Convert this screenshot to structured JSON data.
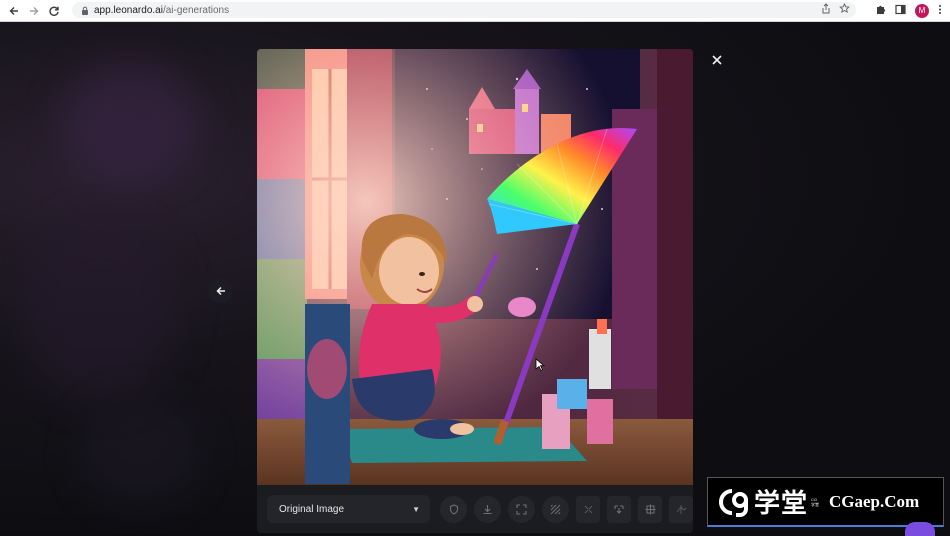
{
  "browser": {
    "url_host": "app.leonardo.ai",
    "url_path": "/ai-generations",
    "profile_initial": "M",
    "icons": [
      "back-icon",
      "forward-icon",
      "reload-icon",
      "lock-icon",
      "share-icon",
      "star-icon",
      "extensions-icon",
      "side-panel-icon",
      "menu-icon"
    ]
  },
  "viewer": {
    "image_mode_label": "Original Image",
    "tools": [
      "shield-icon",
      "download-icon",
      "expand-icon",
      "remove-bg-icon",
      "unzoom-icon",
      "upscale-icon",
      "alchemy-icon",
      "tile-icon"
    ],
    "close_icon": "close-icon",
    "back_icon": "arrow-left-icon"
  },
  "watermark": {
    "brand_cn": "学堂",
    "site": "CGaep.Com",
    "small_text": "CG学堂"
  },
  "colors": {
    "toolbar_bg": "#1b1c20",
    "tool_bg": "#25262b",
    "accent_purple": "#7a4de0",
    "watermark_underline": "#4a7bd6"
  }
}
